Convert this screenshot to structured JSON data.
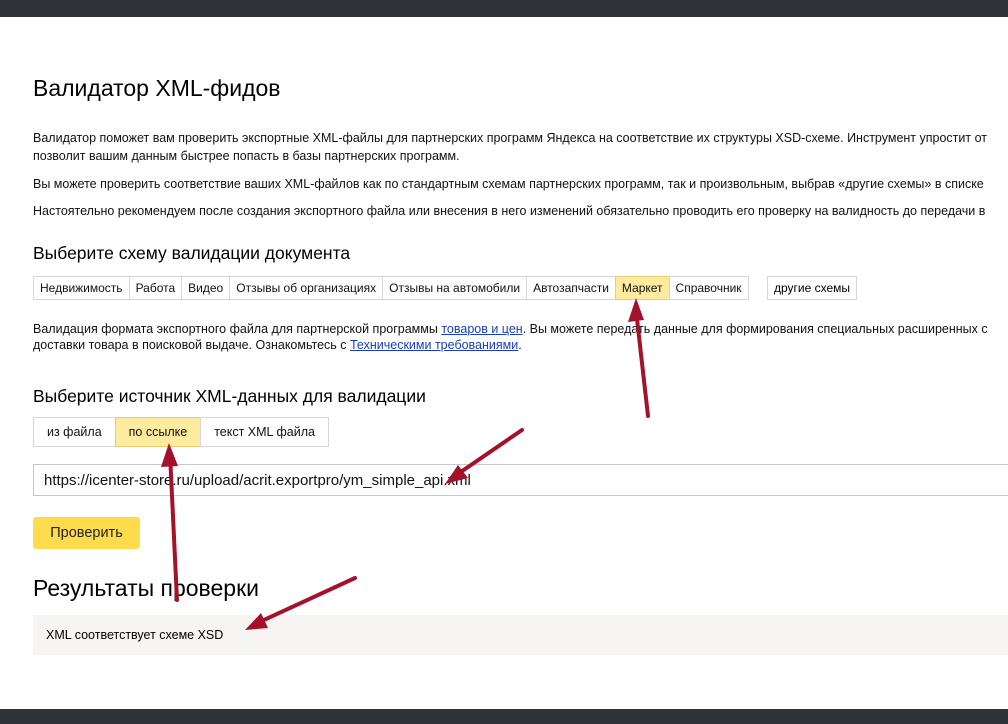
{
  "page": {
    "title": "Валидатор XML-фидов",
    "intro_p1_line1": "Валидатор поможет вам проверить экспортные XML-файлы для партнерских программ Яндекса на соответствие их структуры XSD-схеме. Инструмент упростит от",
    "intro_p1_line2": "позволит вашим данным быстрее попасть в базы партнерских программ.",
    "intro_p2": "Вы можете проверить соответствие ваших XML-файлов как по стандартным схемам партнерских программ, так и произвольным, выбрав «другие схемы» в списке",
    "intro_p3": "Настоятельно рекомендуем после создания экспортного файла или внесения в него изменений обязательно проводить его проверку на валидность до передачи в"
  },
  "schema_section": {
    "heading": "Выберите схему валидации документа",
    "tabs": [
      {
        "label": "Недвижимость"
      },
      {
        "label": "Работа"
      },
      {
        "label": "Видео"
      },
      {
        "label": "Отзывы об организациях"
      },
      {
        "label": "Отзывы на автомобили"
      },
      {
        "label": "Автозапчасти"
      },
      {
        "label": "Маркет"
      },
      {
        "label": "Справочник"
      }
    ],
    "active_tab": "Маркет",
    "other_label": "другие схемы",
    "description_pre": "Валидация формата экспортного файла для партнерской программы ",
    "description_link": "товаров и цен",
    "description_post": ". Вы можете передать данные для формирования специальных расширенных с",
    "description_line2_pre": "доставки товара в поисковой выдаче. Ознакомьтесь с ",
    "description_line2_link": "Техническими требованиями",
    "description_line2_post": "."
  },
  "source_section": {
    "heading": "Выберите источник XML-данных для валидации",
    "tabs": [
      {
        "label": "из файла"
      },
      {
        "label": "по ссылке"
      },
      {
        "label": "текст XML файла"
      }
    ],
    "active_tab": "по ссылке",
    "url_value": "https://icenter-store.ru/upload/acrit.exportpro/ym_simple_api.xml",
    "check_label": "Проверить"
  },
  "results": {
    "heading": "Результаты проверки",
    "message": "XML соответствует схеме XSD"
  },
  "colors": {
    "accent_yellow": "#ffdb4d",
    "active_tab": "#ffeba0",
    "arrow": "#a3122a",
    "dark_bar": "#2f3337"
  }
}
